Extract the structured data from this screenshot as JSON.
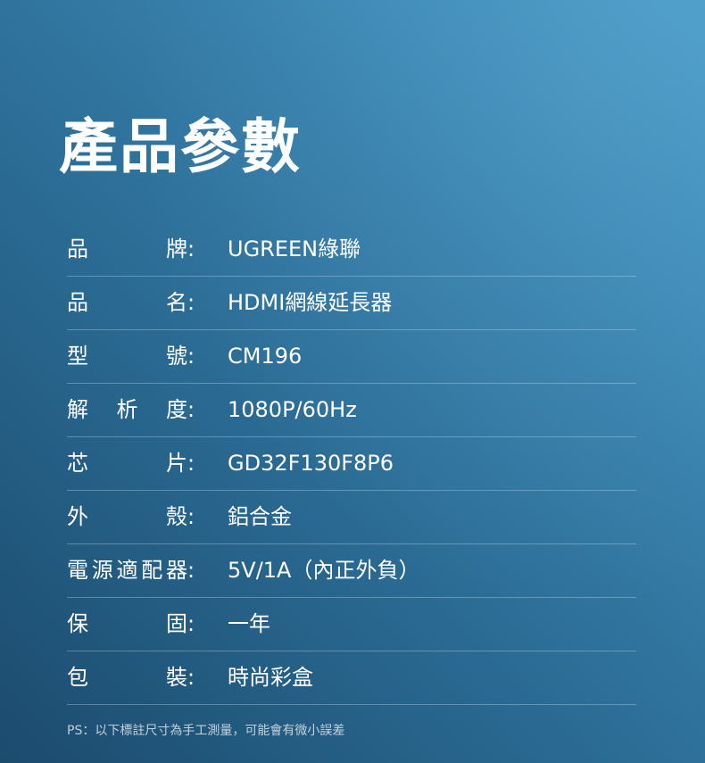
{
  "title": "產品參數",
  "specs": [
    {
      "key": "品牌",
      "colon": ":",
      "value": "UGREEN綠聯"
    },
    {
      "key": "品名",
      "colon": ":",
      "value": "HDMI網線延長器"
    },
    {
      "key": "型號",
      "colon": ":",
      "value": "CM196"
    },
    {
      "key": "解析度",
      "colon": ":",
      "value": "1080P/60Hz"
    },
    {
      "key": "芯片",
      "colon": ":",
      "value": "GD32F130F8P6"
    },
    {
      "key": "外殼",
      "colon": ":",
      "value": "鋁合金"
    },
    {
      "key": "電源適配器",
      "colon": ":",
      "value": "5V/1A（內正外負）"
    },
    {
      "key": "保固",
      "colon": ":",
      "value": "一年"
    },
    {
      "key": "包裝",
      "colon": ":",
      "value": "時尚彩盒"
    }
  ],
  "note": "PS：以下標註尺寸為手工測量，可能會有微小誤差"
}
